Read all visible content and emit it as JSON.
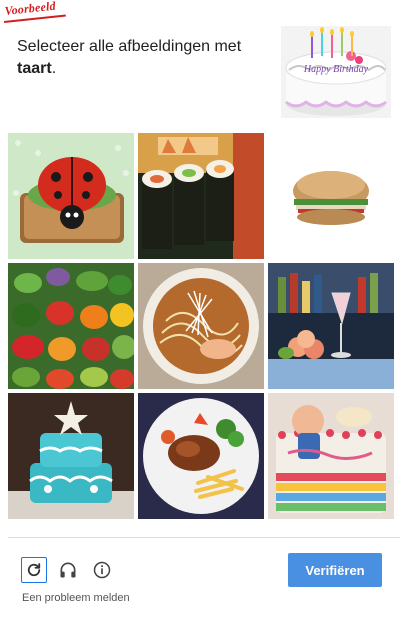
{
  "watermark": "Voorbeeld",
  "instruction": {
    "text": "Selecteer alle afbeeldingen met",
    "keyword": "taart",
    "suffix": "."
  },
  "sample_image": {
    "content": "birthday cake",
    "text": "Happy Birthday"
  },
  "grid": {
    "tiles": [
      {
        "content": "ladybug tomato sandwich"
      },
      {
        "content": "sushi rolls"
      },
      {
        "content": "sandwich"
      },
      {
        "content": "vegetables"
      },
      {
        "content": "ramen noodles"
      },
      {
        "content": "drinks and fruit at bar"
      },
      {
        "content": "blue decorated cake"
      },
      {
        "content": "plate with fries"
      },
      {
        "content": "colorful decorated cake"
      }
    ]
  },
  "footer": {
    "reload_icon": "reload-icon",
    "audio_icon": "headphones-icon",
    "info_icon": "info-icon",
    "report_label": "Een probleem melden",
    "verify_label": "Verifiëren"
  },
  "colors": {
    "accent": "#4a90e2",
    "focus": "#1a73e8",
    "watermark": "#d21e1e"
  }
}
